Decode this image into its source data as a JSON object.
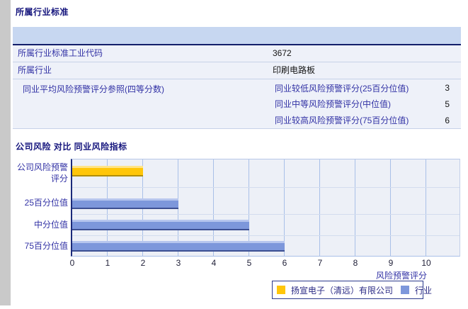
{
  "section_industry": {
    "title": "所属行业标准"
  },
  "industry_table": {
    "header": "",
    "rows": [
      {
        "label": "所属行业标准工业代码",
        "value": "3672"
      },
      {
        "label": "所属行业",
        "value": "印刷电路板"
      },
      {
        "label": "同业平均风险预警评分参照(四等分数)",
        "subrows": [
          {
            "label": "同业较低风险预警评分(25百分位值)",
            "value": "3"
          },
          {
            "label": "同业中等风险预警评分(中位值)",
            "value": "5"
          },
          {
            "label": "同业较高风险预警评分(75百分位值)",
            "value": "6"
          }
        ]
      }
    ]
  },
  "section_chart": {
    "title": "公司风险 对比 同业风险指标"
  },
  "chart_data": {
    "type": "bar",
    "orientation": "horizontal",
    "categories": [
      "公司风险预警评分",
      "25百分位值",
      "中分位值",
      "75百分位值"
    ],
    "series": [
      {
        "name": "扬宣电子（清远）有限公司",
        "color": "#FFC60A",
        "values": [
          2,
          null,
          null,
          null
        ]
      },
      {
        "name": "行业",
        "color": "#7D97DB",
        "values": [
          null,
          3,
          5,
          6
        ]
      }
    ],
    "xlabel": "风险预警评分",
    "xlim": [
      0,
      10
    ],
    "xticks": [
      0,
      1,
      2,
      3,
      4,
      5,
      6,
      7,
      8,
      9,
      10
    ],
    "grid": true,
    "legend_position": "bottom-right"
  },
  "colors": {
    "company_series": "#FFC60A",
    "industry_series": "#7D97DB",
    "table_header_bg": "#C7D7F1",
    "accent_navy": "#131F6B"
  }
}
